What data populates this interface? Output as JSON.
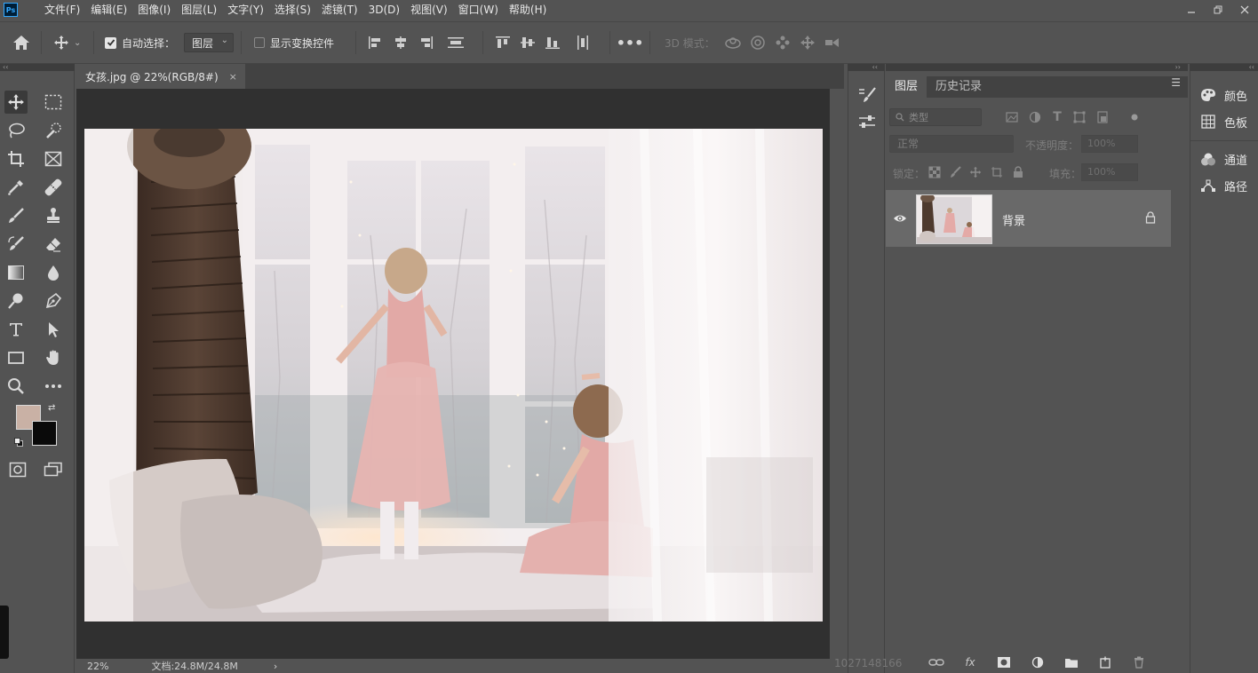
{
  "app": {
    "logo_text": "Ps"
  },
  "menu": [
    "文件(F)",
    "编辑(E)",
    "图像(I)",
    "图层(L)",
    "文字(Y)",
    "选择(S)",
    "滤镜(T)",
    "3D(D)",
    "视图(V)",
    "窗口(W)",
    "帮助(H)"
  ],
  "options_bar": {
    "auto_select_label": "自动选择：",
    "auto_select_value": "图层",
    "show_transform_label": "显示变换控件",
    "mode_3d_label": "3D 模式："
  },
  "document": {
    "tab_title": "女孩.jpg @ 22%(RGB/8#)",
    "close_symbol": "×"
  },
  "status_bar": {
    "zoom": "22%",
    "doc_info": "文档:24.8M/24.8M",
    "arrow": "›"
  },
  "layers_panel": {
    "tabs": [
      "图层",
      "历史记录"
    ],
    "filter_placeholder": "类型",
    "blend_mode": "正常",
    "opacity_label": "不透明度：",
    "opacity_value": "100%",
    "lock_label": "锁定：",
    "fill_label": "填充：",
    "fill_value": "100%",
    "layers": [
      {
        "name": "背景"
      }
    ],
    "footer_fx": "fx"
  },
  "watermark": "1027148166",
  "right_panels": [
    "颜色",
    "色板",
    "通道",
    "路径"
  ],
  "colors": {
    "foreground": "#c9b1a5",
    "background": "#0a0a0a"
  }
}
